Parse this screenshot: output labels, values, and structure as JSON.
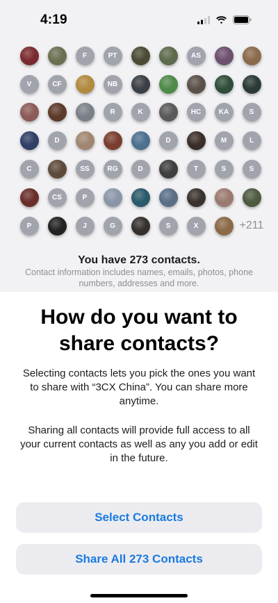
{
  "status_bar": {
    "time": "4:19",
    "signal_icon": "cellular-signal-icon",
    "wifi_icon": "wifi-icon",
    "battery_icon": "battery-icon"
  },
  "contacts_grid": {
    "avatars": [
      {
        "type": "photo",
        "color": "#7a2a2e"
      },
      {
        "type": "photo",
        "color": "#6b6f52"
      },
      {
        "type": "initials",
        "label": "F"
      },
      {
        "type": "initials",
        "label": "PT"
      },
      {
        "type": "photo",
        "color": "#4b4a35"
      },
      {
        "type": "photo",
        "color": "#5d6a4c"
      },
      {
        "type": "initials",
        "label": "AS"
      },
      {
        "type": "photo",
        "color": "#6d4f6e"
      },
      {
        "type": "photo",
        "color": "#8a6a4a"
      },
      {
        "type": "initials",
        "label": "V"
      },
      {
        "type": "initials",
        "label": "CF"
      },
      {
        "type": "photo",
        "color": "#b08a3e"
      },
      {
        "type": "initials",
        "label": "NB"
      },
      {
        "type": "photo",
        "color": "#3a3f45"
      },
      {
        "type": "photo",
        "color": "#4f8a4a"
      },
      {
        "type": "photo",
        "color": "#5a5048"
      },
      {
        "type": "photo",
        "color": "#2f4d3a"
      },
      {
        "type": "photo",
        "color": "#2b3a36"
      },
      {
        "type": "photo",
        "color": "#8c5a57"
      },
      {
        "type": "photo",
        "color": "#5b3a2a"
      },
      {
        "type": "photo",
        "color": "#7b8088"
      },
      {
        "type": "initials",
        "label": "R"
      },
      {
        "type": "initials",
        "label": "K"
      },
      {
        "type": "photo",
        "color": "#5a5a5a"
      },
      {
        "type": "initials",
        "label": "HC"
      },
      {
        "type": "initials",
        "label": "KA"
      },
      {
        "type": "initials",
        "label": "S"
      },
      {
        "type": "photo",
        "color": "#2f3f66"
      },
      {
        "type": "initials",
        "label": "D"
      },
      {
        "type": "photo",
        "color": "#a08670"
      },
      {
        "type": "photo",
        "color": "#7a3e2e"
      },
      {
        "type": "photo",
        "color": "#4d7090"
      },
      {
        "type": "initials",
        "label": "D"
      },
      {
        "type": "photo",
        "color": "#3b2e28"
      },
      {
        "type": "initials",
        "label": "M"
      },
      {
        "type": "initials",
        "label": "L"
      },
      {
        "type": "initials",
        "label": "C"
      },
      {
        "type": "photo",
        "color": "#5e4a3a"
      },
      {
        "type": "initials",
        "label": "SS"
      },
      {
        "type": "initials",
        "label": "RG"
      },
      {
        "type": "initials",
        "label": "D"
      },
      {
        "type": "photo",
        "color": "#3e3e3e"
      },
      {
        "type": "initials",
        "label": "T"
      },
      {
        "type": "initials",
        "label": "S"
      },
      {
        "type": "initials",
        "label": "S"
      },
      {
        "type": "photo",
        "color": "#6a2e2a"
      },
      {
        "type": "initials",
        "label": "CS"
      },
      {
        "type": "initials",
        "label": "P"
      },
      {
        "type": "photo",
        "color": "#8a96a8"
      },
      {
        "type": "photo",
        "color": "#2a5a6a"
      },
      {
        "type": "photo",
        "color": "#5a6e86"
      },
      {
        "type": "photo",
        "color": "#3a322e"
      },
      {
        "type": "photo",
        "color": "#9a7a6e"
      },
      {
        "type": "photo",
        "color": "#4e5a40"
      },
      {
        "type": "initials",
        "label": "P"
      },
      {
        "type": "photo",
        "color": "#222222"
      },
      {
        "type": "initials",
        "label": "J"
      },
      {
        "type": "initials",
        "label": "G"
      },
      {
        "type": "photo",
        "color": "#35302e"
      },
      {
        "type": "initials",
        "label": "S"
      },
      {
        "type": "initials",
        "label": "X"
      },
      {
        "type": "photo",
        "color": "#8a6a48"
      }
    ],
    "more_count": "+211"
  },
  "summary": {
    "title": "You have 273 contacts.",
    "info": "Contact information includes names, emails, photos, phone numbers, addresses and more."
  },
  "prompt": {
    "heading": "How do you want to share contacts?",
    "paragraph1": "Selecting contacts lets you pick the ones you want to share with “3CX China”. You can share more anytime.",
    "paragraph2": "Sharing all contacts will provide full access to all your current contacts as well as any you add or edit in the future."
  },
  "buttons": {
    "select_label": "Select Contacts",
    "share_all_label": "Share All 273 Contacts"
  },
  "colors": {
    "accent": "#1a7ae0",
    "button_bg": "#ececf0",
    "initials_avatar": "#a2a4ad",
    "top_bg": "#f2f2f4"
  }
}
